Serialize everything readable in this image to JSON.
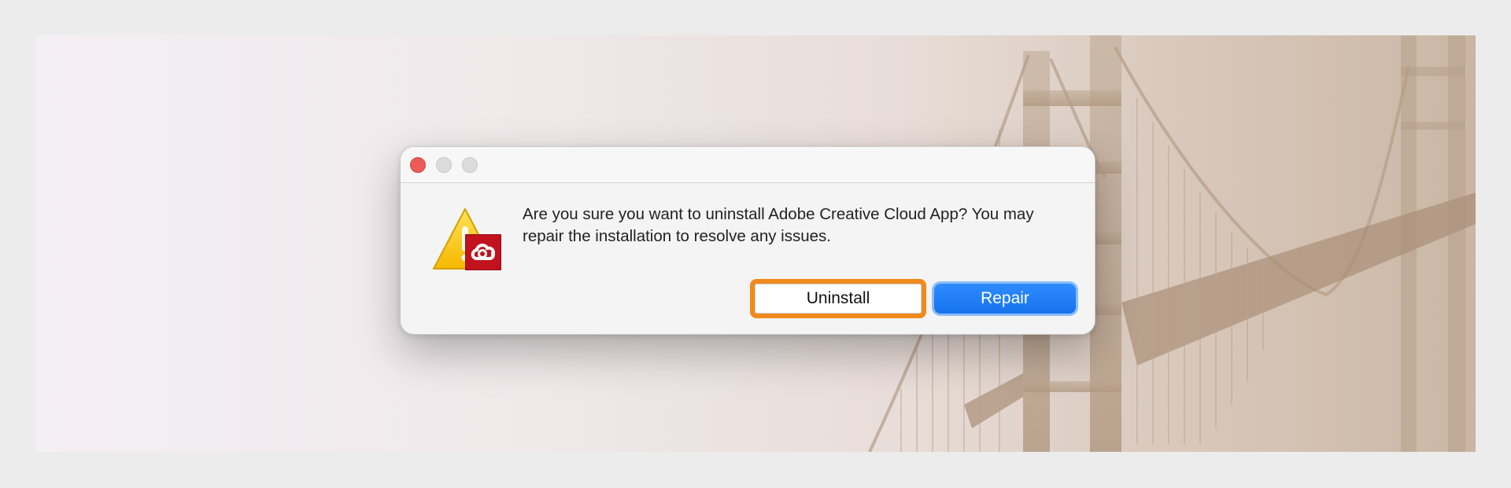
{
  "dialog": {
    "message": "Are you sure you want to uninstall Adobe Creative Cloud App? You may repair the installation to resolve any issues.",
    "buttons": {
      "uninstall": "Uninstall",
      "repair": "Repair"
    }
  },
  "icons": {
    "window_controls": [
      "close-icon",
      "minimize-icon",
      "maximize-icon"
    ],
    "alert": "warning-icon",
    "app_badge": "adobe-creative-cloud-icon"
  },
  "colors": {
    "highlight": "#f08a1c",
    "primary_button": "#1e7bf5",
    "close_control": "#ec5b55"
  }
}
